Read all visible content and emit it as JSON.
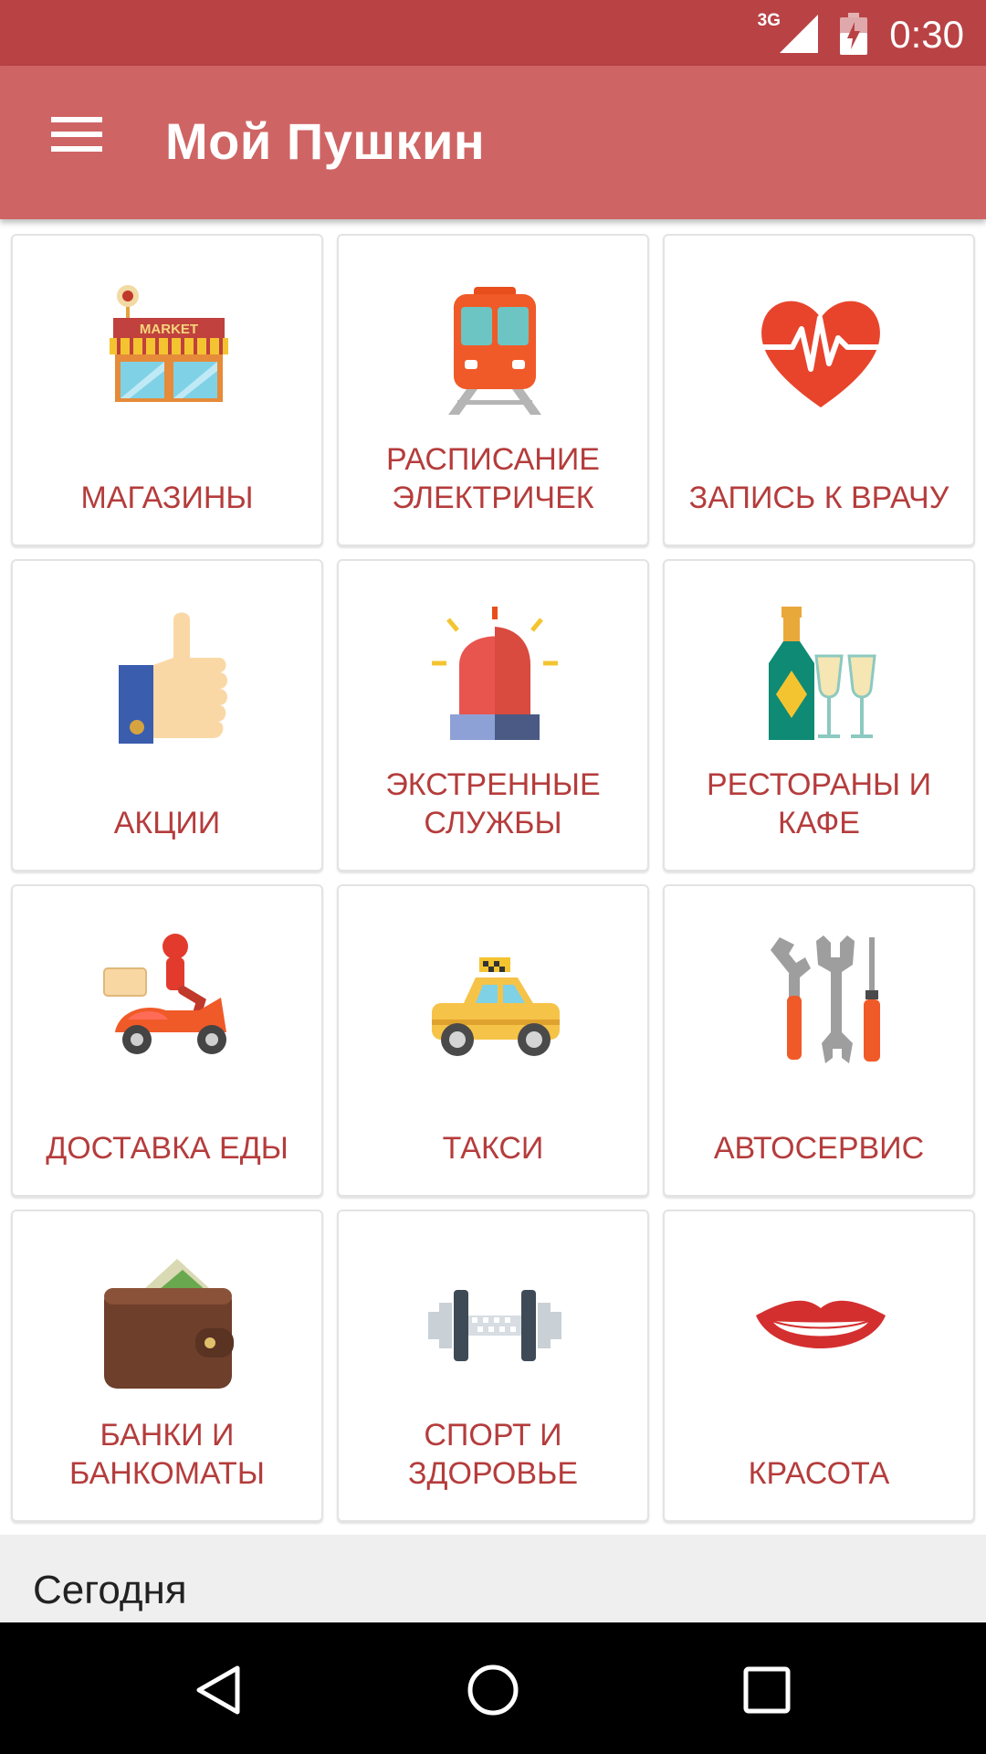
{
  "status_bar": {
    "network": "3G",
    "time": "0:30"
  },
  "app_bar": {
    "title": "Мой Пушкин",
    "menu_icon": "hamburger-menu-icon"
  },
  "tiles": [
    {
      "label": "МАГАЗИНЫ",
      "icon": "market-store-icon"
    },
    {
      "label": "РАСПИСАНИЕ\nЭЛЕКТРИЧЕК",
      "icon": "train-icon"
    },
    {
      "label": "ЗАПИСЬ К ВРАЧУ",
      "icon": "heart-pulse-icon"
    },
    {
      "label": "АКЦИИ",
      "icon": "thumbs-up-icon"
    },
    {
      "label": "ЭКСТРЕННЫЕ\nСЛУЖБЫ",
      "icon": "siren-icon"
    },
    {
      "label": "РЕСТОРАНЫ И\nКАФЕ",
      "icon": "champagne-glasses-icon"
    },
    {
      "label": "ДОСТАВКА ЕДЫ",
      "icon": "delivery-scooter-icon"
    },
    {
      "label": "ТАКСИ",
      "icon": "taxi-icon"
    },
    {
      "label": "АВТОСЕРВИС",
      "icon": "tools-icon"
    },
    {
      "label": "БАНКИ И\nБАНКОМАТЫ",
      "icon": "wallet-icon"
    },
    {
      "label": "СПОРТ И\nЗДОРОВЬЕ",
      "icon": "dumbbell-icon"
    },
    {
      "label": "КРАСОТА",
      "icon": "lips-icon"
    }
  ],
  "market_sign": "MARKET",
  "section": {
    "today_label": "Сегодня"
  },
  "colors": {
    "status_bar": "#b94245",
    "app_bar": "#cf6464",
    "tile_label": "#b53c3c"
  }
}
